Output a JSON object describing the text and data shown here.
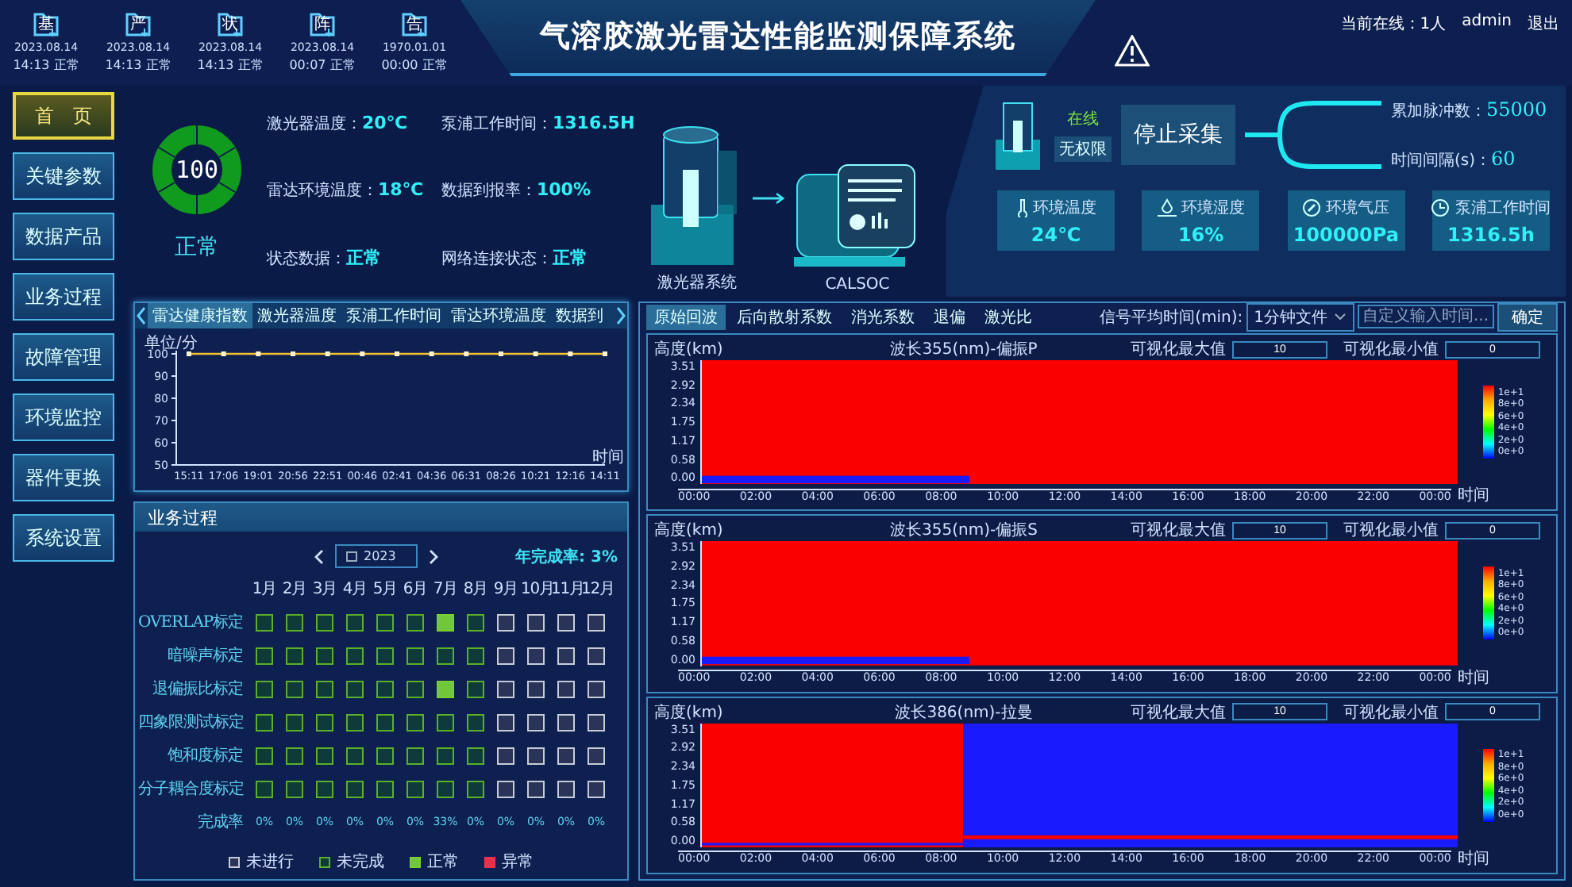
{
  "header": {
    "devices": [
      {
        "badge": "基",
        "date": "2023.08.14",
        "time": "14:13",
        "status": "正常"
      },
      {
        "badge": "严",
        "date": "2023.08.14",
        "time": "14:13",
        "status": "正常"
      },
      {
        "badge": "状",
        "date": "2023.08.14",
        "time": "14:13",
        "status": "正常"
      },
      {
        "badge": "阵",
        "date": "2023.08.14",
        "time": "00:07",
        "status": "正常"
      },
      {
        "badge": "告",
        "date": "1970.01.01",
        "time": "00:00",
        "status": "正常"
      }
    ],
    "title": "气溶胶激光雷达性能监测保障系统",
    "online": "当前在线：1人",
    "user": "admin",
    "logout": "退出"
  },
  "sidebar": {
    "items": [
      {
        "label": "首　页",
        "selected": true
      },
      {
        "label": "关键参数",
        "selected": false
      },
      {
        "label": "数据产品",
        "selected": false
      },
      {
        "label": "业务过程",
        "selected": false
      },
      {
        "label": "故障管理",
        "selected": false
      },
      {
        "label": "环境监控",
        "selected": false
      },
      {
        "label": "器件更换",
        "selected": false
      },
      {
        "label": "系统设置",
        "selected": false
      }
    ]
  },
  "status": {
    "score": "100",
    "state": "正常",
    "fields": [
      {
        "label": "激光器温度：",
        "value": "20℃"
      },
      {
        "label": "泵浦工作时间：",
        "value": "1316.5H"
      },
      {
        "label": "雷达环境温度：",
        "value": "18℃"
      },
      {
        "label": "数据到报率：",
        "value": "100%"
      },
      {
        "label": "状态数据：",
        "value": "正常"
      },
      {
        "label": "网络连接状态：",
        "value": "正常"
      }
    ]
  },
  "diagram": {
    "laser_label": "激光器系统",
    "calsoc_label": "CALSOC"
  },
  "acquisition": {
    "online": "在线",
    "permission": "无权限",
    "button": "停止采集",
    "counters": [
      {
        "label": "累加脉冲数：",
        "value": "55000"
      },
      {
        "label": "时间间隔(s)：",
        "value": "60"
      }
    ],
    "env": [
      {
        "kind": "temperature",
        "label": "环境温度",
        "value": "24℃"
      },
      {
        "kind": "humidity",
        "label": "环境湿度",
        "value": "16%"
      },
      {
        "kind": "pressure",
        "label": "环境气压",
        "value": "100000Pa"
      },
      {
        "kind": "time",
        "label": "泵浦工作时间",
        "value": "1316.5h"
      }
    ]
  },
  "health": {
    "tabs": [
      {
        "label": "雷达健康指数",
        "selected": true
      },
      {
        "label": "激光器温度",
        "selected": false
      },
      {
        "label": "泵浦工作时间",
        "selected": false
      },
      {
        "label": "雷达环境温度",
        "selected": false
      },
      {
        "label": "数据到",
        "selected": false
      }
    ],
    "chart_data": {
      "type": "line",
      "ylabel": "单位/分",
      "xlabel": "时间",
      "categories": [
        "15:11",
        "17:06",
        "19:01",
        "20:56",
        "22:51",
        "00:46",
        "02:41",
        "04:36",
        "06:31",
        "08:26",
        "10:21",
        "12:16",
        "14:11"
      ],
      "series": [
        {
          "color": "#f2c230",
          "marker": "square",
          "values": [
            100,
            100,
            100,
            100,
            100,
            100,
            100,
            100,
            100,
            100,
            100,
            100,
            100
          ]
        }
      ],
      "ylim": [
        50,
        100
      ],
      "yticks": [
        50,
        60,
        70,
        80,
        90,
        100
      ]
    }
  },
  "process": {
    "title": "业务过程",
    "year": "2023",
    "annual_label": "年完成率:",
    "annual_value": "3%",
    "months": [
      "1月",
      "2月",
      "3月",
      "4月",
      "5月",
      "6月",
      "7月",
      "8月",
      "9月",
      "10月",
      "11月",
      "12月"
    ],
    "rows": [
      {
        "label": "OVERLAP标定",
        "cells": [
          {
            "kind": "incomplete"
          },
          {
            "kind": "incomplete"
          },
          {
            "kind": "incomplete"
          },
          {
            "kind": "incomplete"
          },
          {
            "kind": "incomplete"
          },
          {
            "kind": "incomplete"
          },
          {
            "kind": "normal"
          },
          {
            "kind": "incomplete"
          },
          {
            "kind": "not_run"
          },
          {
            "kind": "not_run"
          },
          {
            "kind": "not_run"
          },
          {
            "kind": "not_run"
          }
        ]
      },
      {
        "label": "暗噪声标定",
        "cells": [
          {
            "kind": "incomplete"
          },
          {
            "kind": "incomplete"
          },
          {
            "kind": "incomplete"
          },
          {
            "kind": "incomplete"
          },
          {
            "kind": "incomplete"
          },
          {
            "kind": "incomplete"
          },
          {
            "kind": "incomplete"
          },
          {
            "kind": "incomplete"
          },
          {
            "kind": "not_run"
          },
          {
            "kind": "not_run"
          },
          {
            "kind": "not_run"
          },
          {
            "kind": "not_run"
          }
        ]
      },
      {
        "label": "退偏振比标定",
        "cells": [
          {
            "kind": "incomplete"
          },
          {
            "kind": "incomplete"
          },
          {
            "kind": "incomplete"
          },
          {
            "kind": "incomplete"
          },
          {
            "kind": "incomplete"
          },
          {
            "kind": "incomplete"
          },
          {
            "kind": "normal"
          },
          {
            "kind": "incomplete"
          },
          {
            "kind": "not_run"
          },
          {
            "kind": "not_run"
          },
          {
            "kind": "not_run"
          },
          {
            "kind": "not_run"
          }
        ]
      },
      {
        "label": "四象限测试标定",
        "cells": [
          {
            "kind": "incomplete"
          },
          {
            "kind": "incomplete"
          },
          {
            "kind": "incomplete"
          },
          {
            "kind": "incomplete"
          },
          {
            "kind": "incomplete"
          },
          {
            "kind": "incomplete"
          },
          {
            "kind": "incomplete"
          },
          {
            "kind": "incomplete"
          },
          {
            "kind": "not_run"
          },
          {
            "kind": "not_run"
          },
          {
            "kind": "not_run"
          },
          {
            "kind": "not_run"
          }
        ]
      },
      {
        "label": "饱和度标定",
        "cells": [
          {
            "kind": "incomplete"
          },
          {
            "kind": "incomplete"
          },
          {
            "kind": "incomplete"
          },
          {
            "kind": "incomplete"
          },
          {
            "kind": "incomplete"
          },
          {
            "kind": "incomplete"
          },
          {
            "kind": "incomplete"
          },
          {
            "kind": "incomplete"
          },
          {
            "kind": "not_run"
          },
          {
            "kind": "not_run"
          },
          {
            "kind": "not_run"
          },
          {
            "kind": "not_run"
          }
        ]
      },
      {
        "label": "分子耦合度标定",
        "cells": [
          {
            "kind": "incomplete"
          },
          {
            "kind": "incomplete"
          },
          {
            "kind": "incomplete"
          },
          {
            "kind": "incomplete"
          },
          {
            "kind": "incomplete"
          },
          {
            "kind": "incomplete"
          },
          {
            "kind": "incomplete"
          },
          {
            "kind": "incomplete"
          },
          {
            "kind": "not_run"
          },
          {
            "kind": "not_run"
          },
          {
            "kind": "not_run"
          },
          {
            "kind": "not_run"
          }
        ]
      }
    ],
    "rate_label": "完成率",
    "rates": [
      "0%",
      "0%",
      "0%",
      "0%",
      "0%",
      "0%",
      "33%",
      "0%",
      "0%",
      "0%",
      "0%",
      "0%"
    ],
    "legend": [
      {
        "kind": "not_run",
        "label": "未进行"
      },
      {
        "kind": "incomplete",
        "label": "未完成"
      },
      {
        "kind": "normal",
        "label": "正常"
      },
      {
        "kind": "abnormal",
        "label": "异常"
      }
    ]
  },
  "signals": {
    "tabs": [
      {
        "label": "原始回波",
        "selected": true
      },
      {
        "label": "后向散射系数",
        "selected": false
      },
      {
        "label": "消光系数",
        "selected": false
      },
      {
        "label": "退偏",
        "selected": false
      },
      {
        "label": "激光比",
        "selected": false
      }
    ],
    "avg_label": "信号平均时间(min):",
    "avg_value": "1分钟文件",
    "custom_placeholder": "自定义输入时间...",
    "confirm": "确定",
    "plots": [
      {
        "kind": "baseline",
        "title": "波长355(nm)-偏振P",
        "ylabel": "高度(km)",
        "xlabel": "时间",
        "max_label": "可视化最大值",
        "max_value": "10",
        "min_label": "可视化最小值",
        "min_value": "0",
        "yticks": [
          "3.51",
          "2.92",
          "2.34",
          "1.75",
          "1.17",
          "0.58",
          "0.00"
        ],
        "xticks": [
          "00:00",
          "02:00",
          "04:00",
          "06:00",
          "08:00",
          "10:00",
          "12:00",
          "14:00",
          "16:00",
          "18:00",
          "20:00",
          "22:00",
          "00:00"
        ],
        "colorbar": [
          "1e+1",
          "8e+0",
          "6e+0",
          "4e+0",
          "2e+0",
          "0e+0"
        ]
      },
      {
        "kind": "baseline",
        "title": "波长355(nm)-偏振S",
        "ylabel": "高度(km)",
        "xlabel": "时间",
        "max_label": "可视化最大值",
        "max_value": "10",
        "min_label": "可视化最小值",
        "min_value": "0",
        "yticks": [
          "3.51",
          "2.92",
          "2.34",
          "1.75",
          "1.17",
          "0.58",
          "0.00"
        ],
        "xticks": [
          "00:00",
          "02:00",
          "04:00",
          "06:00",
          "08:00",
          "10:00",
          "12:00",
          "14:00",
          "16:00",
          "18:00",
          "20:00",
          "22:00",
          "00:00"
        ],
        "colorbar": [
          "1e+1",
          "8e+0",
          "6e+0",
          "4e+0",
          "2e+0",
          "0e+0"
        ]
      },
      {
        "kind": "split",
        "title": "波长386(nm)-拉曼",
        "ylabel": "高度(km)",
        "xlabel": "时间",
        "max_label": "可视化最大值",
        "max_value": "10",
        "min_label": "可视化最小值",
        "min_value": "0",
        "yticks": [
          "3.51",
          "2.92",
          "2.34",
          "1.75",
          "1.17",
          "0.58",
          "0.00"
        ],
        "xticks": [
          "00:00",
          "02:00",
          "04:00",
          "06:00",
          "08:00",
          "10:00",
          "12:00",
          "14:00",
          "16:00",
          "18:00",
          "20:00",
          "22:00",
          "00:00"
        ],
        "colorbar": [
          "1e+1",
          "8e+0",
          "6e+0",
          "4e+0",
          "2e+0",
          "0e+0"
        ]
      }
    ]
  }
}
